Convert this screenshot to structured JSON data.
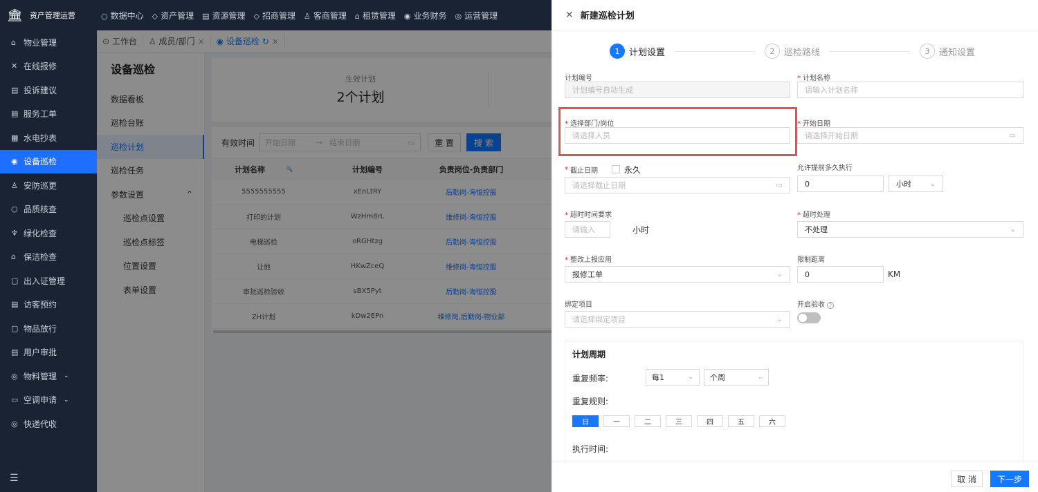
{
  "app": {
    "name": "资产管理运营",
    "logo_icon": "bank-icon"
  },
  "top_nav": [
    {
      "label": "数据中心",
      "icon": "○"
    },
    {
      "label": "资产管理",
      "icon": "◇"
    },
    {
      "label": "资源管理",
      "icon": "▤"
    },
    {
      "label": "招商管理",
      "icon": "◇"
    },
    {
      "label": "客商管理",
      "icon": "♙"
    },
    {
      "label": "租赁管理",
      "icon": "⌂"
    },
    {
      "label": "业务财务",
      "icon": "◉"
    },
    {
      "label": "运营管理",
      "icon": "◎"
    }
  ],
  "sidebar": {
    "items": [
      {
        "label": "物业管理",
        "icon": "⌂"
      },
      {
        "label": "在线报修",
        "icon": "✕"
      },
      {
        "label": "投诉建议",
        "icon": "▤"
      },
      {
        "label": "服务工单",
        "icon": "▤"
      },
      {
        "label": "水电抄表",
        "icon": "▦"
      },
      {
        "label": "设备巡检",
        "icon": "◉"
      },
      {
        "label": "安防巡更",
        "icon": "♙"
      },
      {
        "label": "品质核查",
        "icon": "○"
      },
      {
        "label": "绿化检查",
        "icon": "♆"
      },
      {
        "label": "保洁检查",
        "icon": "⌂"
      },
      {
        "label": "出入证管理",
        "icon": "▢"
      },
      {
        "label": "访客预约",
        "icon": "▤"
      },
      {
        "label": "物品放行",
        "icon": "▢"
      },
      {
        "label": "用户审批",
        "icon": "▤"
      },
      {
        "label": "物料管理",
        "icon": "◎",
        "chevron": "⌄"
      },
      {
        "label": "空调申请",
        "icon": "▭",
        "chevron": "⌄"
      },
      {
        "label": "快递代收",
        "icon": "◎"
      }
    ],
    "collapse_icon": "☰"
  },
  "tabs": [
    {
      "label": "工作台",
      "icon": "⊙"
    },
    {
      "label": "成员/部门",
      "icon": "♙",
      "close": "×"
    },
    {
      "label": "设备巡检",
      "icon": "◉",
      "refresh": "↻",
      "close": "×"
    }
  ],
  "subnav": {
    "title": "设备巡检",
    "items": [
      {
        "label": "数据看板"
      },
      {
        "label": "巡检台账"
      },
      {
        "label": "巡检计划"
      },
      {
        "label": "巡检任务"
      },
      {
        "label": "参数设置",
        "chevron": "⌃"
      },
      {
        "label": "巡检点设置"
      },
      {
        "label": "巡检点标签"
      },
      {
        "label": "位置设置"
      },
      {
        "label": "表单设置"
      }
    ]
  },
  "summary": {
    "label": "生效计划",
    "value": "2个计划"
  },
  "filter": {
    "label": "有效时间",
    "start_placeholder": "开始日期",
    "arrow": "→",
    "end_placeholder": "结束日期",
    "calendar_icon": "▭",
    "reset": "重 置",
    "search": "搜 索"
  },
  "table": {
    "headers": [
      "计划名称",
      "计划编号",
      "负责岗位-负责部门"
    ],
    "search_icon": "🔍",
    "rows": [
      [
        "5555555555",
        "xEnLtRY",
        "后勤岗-海恒控股"
      ],
      [
        "打印的计划",
        "WzHm8rL",
        "维修岗-海恒控股"
      ],
      [
        "电梯巡检",
        "oRGHtzg",
        "后勤岗-海恒控股"
      ],
      [
        "让他",
        "HKwZceQ",
        "维修岗-海恒控股"
      ],
      [
        "审批巡检验收",
        "sBX5Pyt",
        "后勤岗-海恒控股"
      ],
      [
        "ZH计划",
        "kDw2EPn",
        "维修岗,后勤岗-物业部"
      ]
    ]
  },
  "panel": {
    "title": "新建巡检计划",
    "close_icon": "✕",
    "steps": [
      {
        "num": "1",
        "label": "计划设置"
      },
      {
        "num": "2",
        "label": "巡检路线"
      },
      {
        "num": "3",
        "label": "通知设置"
      }
    ],
    "req_mark": "*",
    "fields": {
      "plan_no": {
        "label": "计划编号",
        "placeholder": "计划编号自动生成"
      },
      "plan_name": {
        "label": "计划名称",
        "placeholder": "请输入计划名称"
      },
      "dept": {
        "label": "选择部门/岗位",
        "placeholder": "请选择人员"
      },
      "start_date": {
        "label": "开始日期",
        "placeholder": "请选择开始日期"
      },
      "end_date": {
        "label": "截止日期",
        "placeholder": "请选择截止日期",
        "forever": "永久"
      },
      "advance": {
        "label": "允许提前多久执行",
        "value": "0",
        "unit": "小时"
      },
      "timeout_req": {
        "label": "超时时间要求",
        "placeholder": "请输入",
        "unit": "小时"
      },
      "timeout_handle": {
        "label": "超时处理",
        "value": "不处理"
      },
      "rectify_app": {
        "label": "整改上报应用",
        "value": "报修工单"
      },
      "distance": {
        "label": "限制距离",
        "value": "0",
        "unit": "KM"
      },
      "project": {
        "label": "绑定项目",
        "placeholder": "请选择绑定项目"
      },
      "acceptance": {
        "label": "开启验收",
        "help_icon": "?",
        "on": false
      }
    },
    "period": {
      "title": "计划周期",
      "freq_label": "重复频率:",
      "freq_value": "每1",
      "freq_unit": "个周",
      "rule_label": "重复规则:",
      "days": [
        "日",
        "一",
        "二",
        "三",
        "四",
        "五",
        "六"
      ],
      "selected_day": "日",
      "exec_label": "执行时间:"
    },
    "chevron": "⌄",
    "calendar_icon": "▭",
    "cancel": "取 消",
    "next": "下一步"
  }
}
